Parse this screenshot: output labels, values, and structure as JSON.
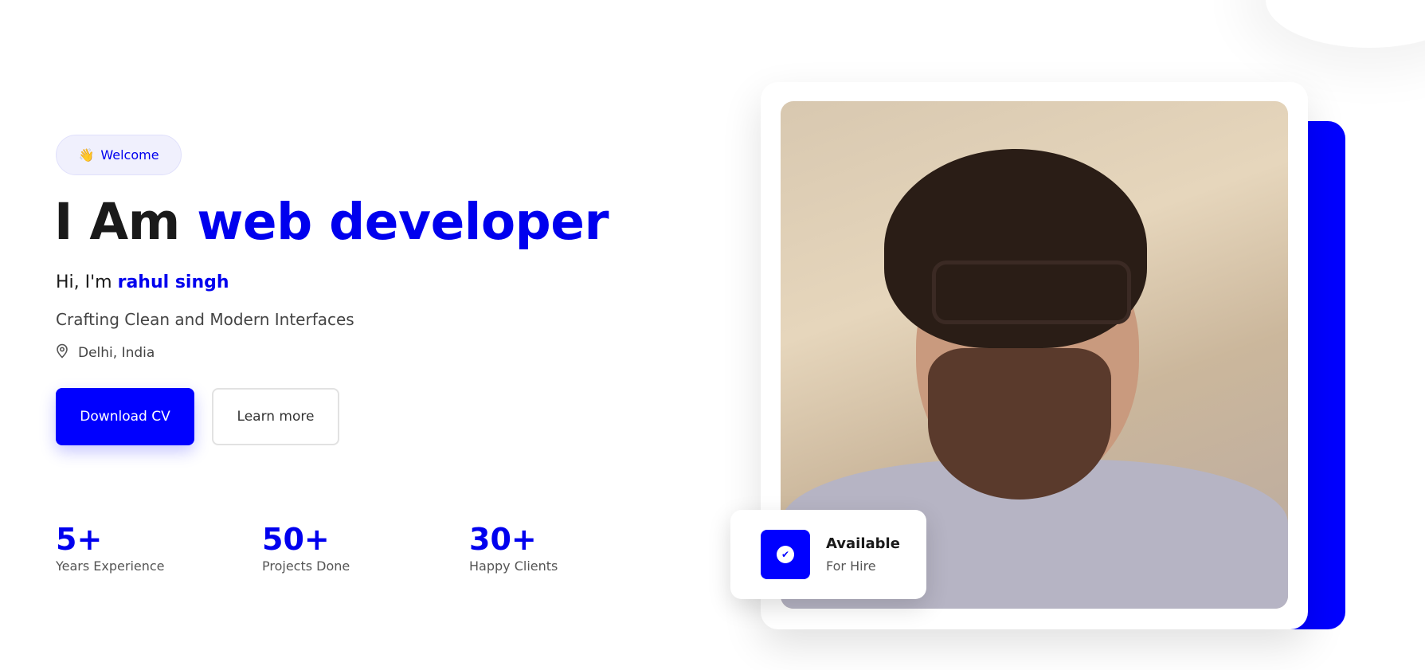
{
  "hero": {
    "badge": {
      "icon": "waving-hand-icon",
      "emoji": "👋",
      "label": "Welcome"
    },
    "heading_prefix": "I Am",
    "heading_accent": "web developer",
    "greeting_prefix": "Hi, I'm",
    "name": "rahul singh",
    "tagline": "Crafting Clean and Modern Interfaces",
    "location": {
      "icon": "map-pin-icon",
      "text": "Delhi, India"
    },
    "buttons": {
      "primary": "Download CV",
      "secondary": "Learn more"
    },
    "stats": [
      {
        "value": "5+",
        "label": "Years Experience"
      },
      {
        "value": "50+",
        "label": "Projects Done"
      },
      {
        "value": "30+",
        "label": "Happy Clients"
      }
    ]
  },
  "availability": {
    "icon": "check-circle-icon",
    "title": "Available",
    "subtitle": "For Hire"
  },
  "colors": {
    "accent": "#0000ff",
    "text": "#1a1a1a",
    "badge_bg": "#f0f0fd"
  }
}
